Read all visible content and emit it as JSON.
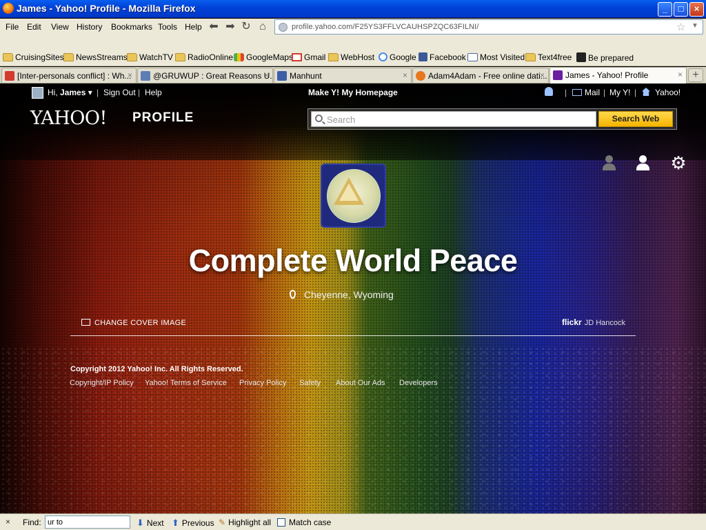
{
  "window": {
    "title": "James - Yahoo! Profile - Mozilla Firefox"
  },
  "menubar": {
    "items": [
      "File",
      "Edit",
      "View",
      "History",
      "Bookmarks",
      "Tools",
      "Help"
    ]
  },
  "urlbar": {
    "url": "profile.yahoo.com/F25YS3FFLVCAUHSPZQC63FILNI/"
  },
  "bookmarks": [
    {
      "label": "CruisingSites",
      "icon": "folder"
    },
    {
      "label": "NewsStreams",
      "icon": "folder"
    },
    {
      "label": "WatchTV",
      "icon": "folder"
    },
    {
      "label": "RadioOnline",
      "icon": "folder"
    },
    {
      "label": "GoogleMaps",
      "icon": "gmaps"
    },
    {
      "label": "Gmail",
      "icon": "gmail"
    },
    {
      "label": "WebHost",
      "icon": "folder"
    },
    {
      "label": "Google",
      "icon": "google"
    },
    {
      "label": "Facebook",
      "icon": "fb"
    },
    {
      "label": "Most Visited",
      "icon": "mv"
    },
    {
      "label": "Text4free",
      "icon": "folder"
    },
    {
      "label": "Be prepared",
      "icon": "prep"
    }
  ],
  "tabs": [
    {
      "title": "[Inter-personals conflict] : Wh...",
      "active": false,
      "icon_color": "#d23b2e"
    },
    {
      "title": "@GRUWUP : Great Reasons U...",
      "active": false,
      "icon_color": "#5d7db5"
    },
    {
      "title": "Manhunt",
      "active": false,
      "icon_color": "#3c5fa8"
    },
    {
      "title": "Adam4Adam - Free online dati...",
      "active": false,
      "icon_color": "#e8771e"
    },
    {
      "title": "James - Yahoo! Profile",
      "active": true,
      "icon_color": "#6a1fa1"
    }
  ],
  "yahoo": {
    "greeting_prefix": "Hi,",
    "user_name": "James",
    "sign_out": "Sign Out",
    "help": "Help",
    "homepage": "Make Y! My Homepage",
    "mail": "Mail",
    "myy": "My Y!",
    "yahoo": "Yahoo!",
    "logo": "YAHOO!",
    "section": "PROFILE",
    "search_placeholder": "Search",
    "search_button": "Search Web",
    "profile_name": "Complete World Peace",
    "location": "Cheyenne, Wyoming",
    "change_cover": "CHANGE COVER IMAGE",
    "flickr": "flickr",
    "photo_credit": "JD Hancock",
    "copyright": "Copyright 2012 Yahoo! Inc. All Rights Reserved.",
    "footer_links": [
      "Copyright/IP Policy",
      "Yahoo! Terms of Service",
      "Privacy Policy",
      "Safety",
      "About Our Ads",
      "Developers"
    ]
  },
  "findbar": {
    "label": "Find:",
    "value": "ur to",
    "next": "Next",
    "previous": "Previous",
    "highlight": "Highlight all",
    "match_case": "Match case"
  },
  "colors": {
    "accent_yellow": "#f5b400",
    "xp_blue": "#0043d8"
  }
}
